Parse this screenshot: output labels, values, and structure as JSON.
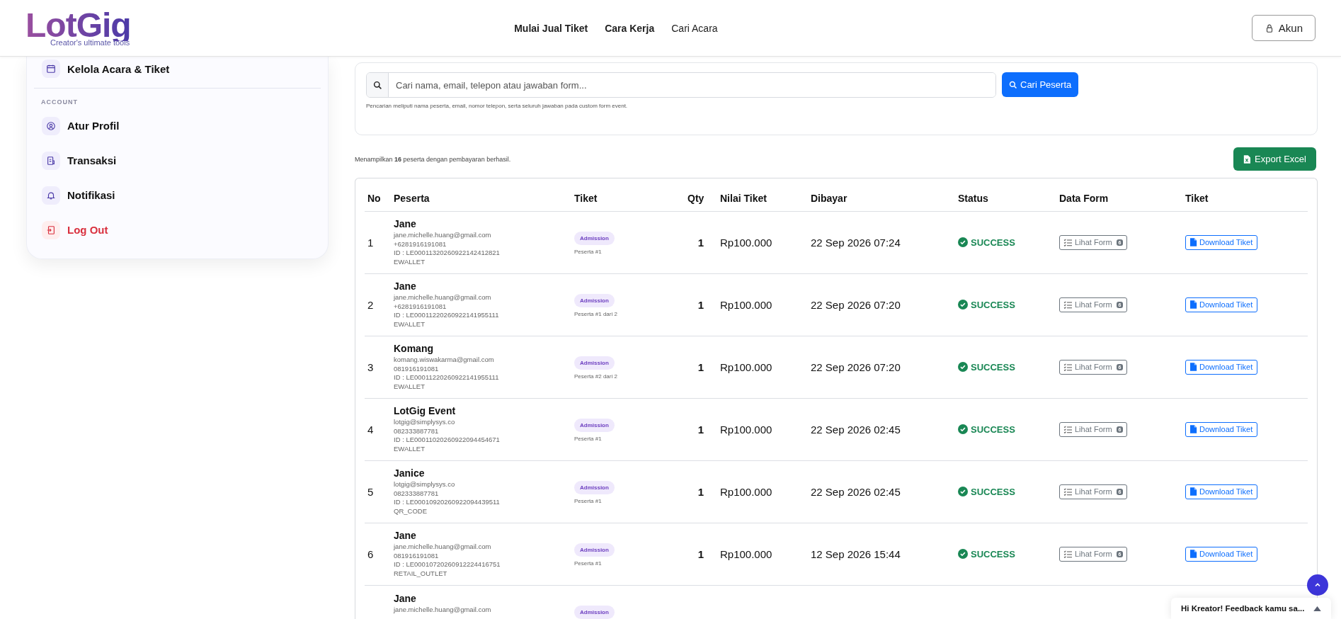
{
  "header": {
    "logo": {
      "name": "LotGig",
      "tagline": "Creator's ultimate tools"
    },
    "nav": [
      {
        "label": "Mulai Jual Tiket",
        "bold": true
      },
      {
        "label": "Cara Kerja",
        "bold": true
      },
      {
        "label": "Cari Acara",
        "bold": false
      }
    ],
    "account_button": "Akun"
  },
  "sidebar": {
    "items": [
      {
        "label": "Kelola Acara & Tiket",
        "kind": "event"
      }
    ],
    "section": "ACCOUNT",
    "account_items": [
      {
        "label": "Atur Profil",
        "kind": "profile",
        "danger": false
      },
      {
        "label": "Transaksi",
        "kind": "receipt",
        "danger": false
      },
      {
        "label": "Notifikasi",
        "kind": "bell",
        "danger": false
      },
      {
        "label": "Log Out",
        "kind": "logout",
        "danger": true
      }
    ]
  },
  "search": {
    "placeholder": "Cari nama, email, telepon atau jawaban form...",
    "button": "Cari Peserta",
    "hint": "Pencarian meliputi nama peserta, email, nomor telepon, serta seluruh jawaban pada custom form event."
  },
  "summary": "Menampilkan **16** peserta dengan pembayaran berhasil.",
  "export_button": "Export Excel",
  "table": {
    "columns": [
      "No",
      "Peserta",
      "Tiket",
      "Qty",
      "Nilai Tiket",
      "Dibayar",
      "Status",
      "Data Form",
      "Tiket"
    ],
    "rows": [
      {
        "no": "1",
        "name": "Jane",
        "email": "jane.michelle.huang@gmail.com",
        "phone": "+6281916191081",
        "id": "ID : LE00011320260922142412821",
        "method": "EWALLET",
        "ticket": "Admission",
        "ticket_note": "Peserta #1",
        "qty": "1",
        "value": "Rp100.000",
        "paid": "22 Sep 2026 07:24",
        "status": "SUCCESS",
        "form_button": "Lihat Form",
        "form_count": "6",
        "download": "Download Tiket"
      },
      {
        "no": "2",
        "name": "Jane",
        "email": "jane.michelle.huang@gmail.com",
        "phone": "+6281916191081",
        "id": "ID : LE00011220260922141955111",
        "method": "EWALLET",
        "ticket": "Admission",
        "ticket_note": "Peserta #1 dari 2",
        "qty": "1",
        "value": "Rp100.000",
        "paid": "22 Sep 2026 07:20",
        "status": "SUCCESS",
        "form_button": "Lihat Form",
        "form_count": "6",
        "download": "Download Tiket"
      },
      {
        "no": "3",
        "name": "Komang",
        "email": "komang.wiswakarma@gmail.com",
        "phone": "081916191081",
        "id": "ID : LE00011220260922141955111",
        "method": "EWALLET",
        "ticket": "Admission",
        "ticket_note": "Peserta #2 dari 2",
        "qty": "1",
        "value": "Rp100.000",
        "paid": "22 Sep 2026 07:20",
        "status": "SUCCESS",
        "form_button": "Lihat Form",
        "form_count": "6",
        "download": "Download Tiket"
      },
      {
        "no": "4",
        "name": "LotGig Event",
        "email": "lotgig@simplysys.co",
        "phone": "082333887781",
        "id": "ID : LE00011020260922094454671",
        "method": "EWALLET",
        "ticket": "Admission",
        "ticket_note": "Peserta #1",
        "qty": "1",
        "value": "Rp100.000",
        "paid": "22 Sep 2026 02:45",
        "status": "SUCCESS",
        "form_button": "Lihat Form",
        "form_count": "6",
        "download": "Download Tiket"
      },
      {
        "no": "5",
        "name": "Janice",
        "email": "lotgig@simplysys.co",
        "phone": "082333887781",
        "id": "ID : LE00010920260922094439511",
        "method": "QR_CODE",
        "ticket": "Admission",
        "ticket_note": "Peserta #1",
        "qty": "1",
        "value": "Rp100.000",
        "paid": "22 Sep 2026 02:45",
        "status": "SUCCESS",
        "form_button": "Lihat Form",
        "form_count": "6",
        "download": "Download Tiket"
      },
      {
        "no": "6",
        "name": "Jane",
        "email": "jane.michelle.huang@gmail.com",
        "phone": "081916191081",
        "id": "ID : LE00010720260912224416751",
        "method": "RETAIL_OUTLET",
        "ticket": "Admission",
        "ticket_note": "Peserta #1",
        "qty": "1",
        "value": "Rp100.000",
        "paid": "12 Sep 2026 15:44",
        "status": "SUCCESS",
        "form_button": "Lihat Form",
        "form_count": "6",
        "download": "Download Tiket"
      },
      {
        "name": "Jane",
        "email": "jane.michelle.huang@gmail.com",
        "ticket": "Admission"
      }
    ]
  },
  "feedback": "Hi Kreator! Feedback kamu sa..."
}
